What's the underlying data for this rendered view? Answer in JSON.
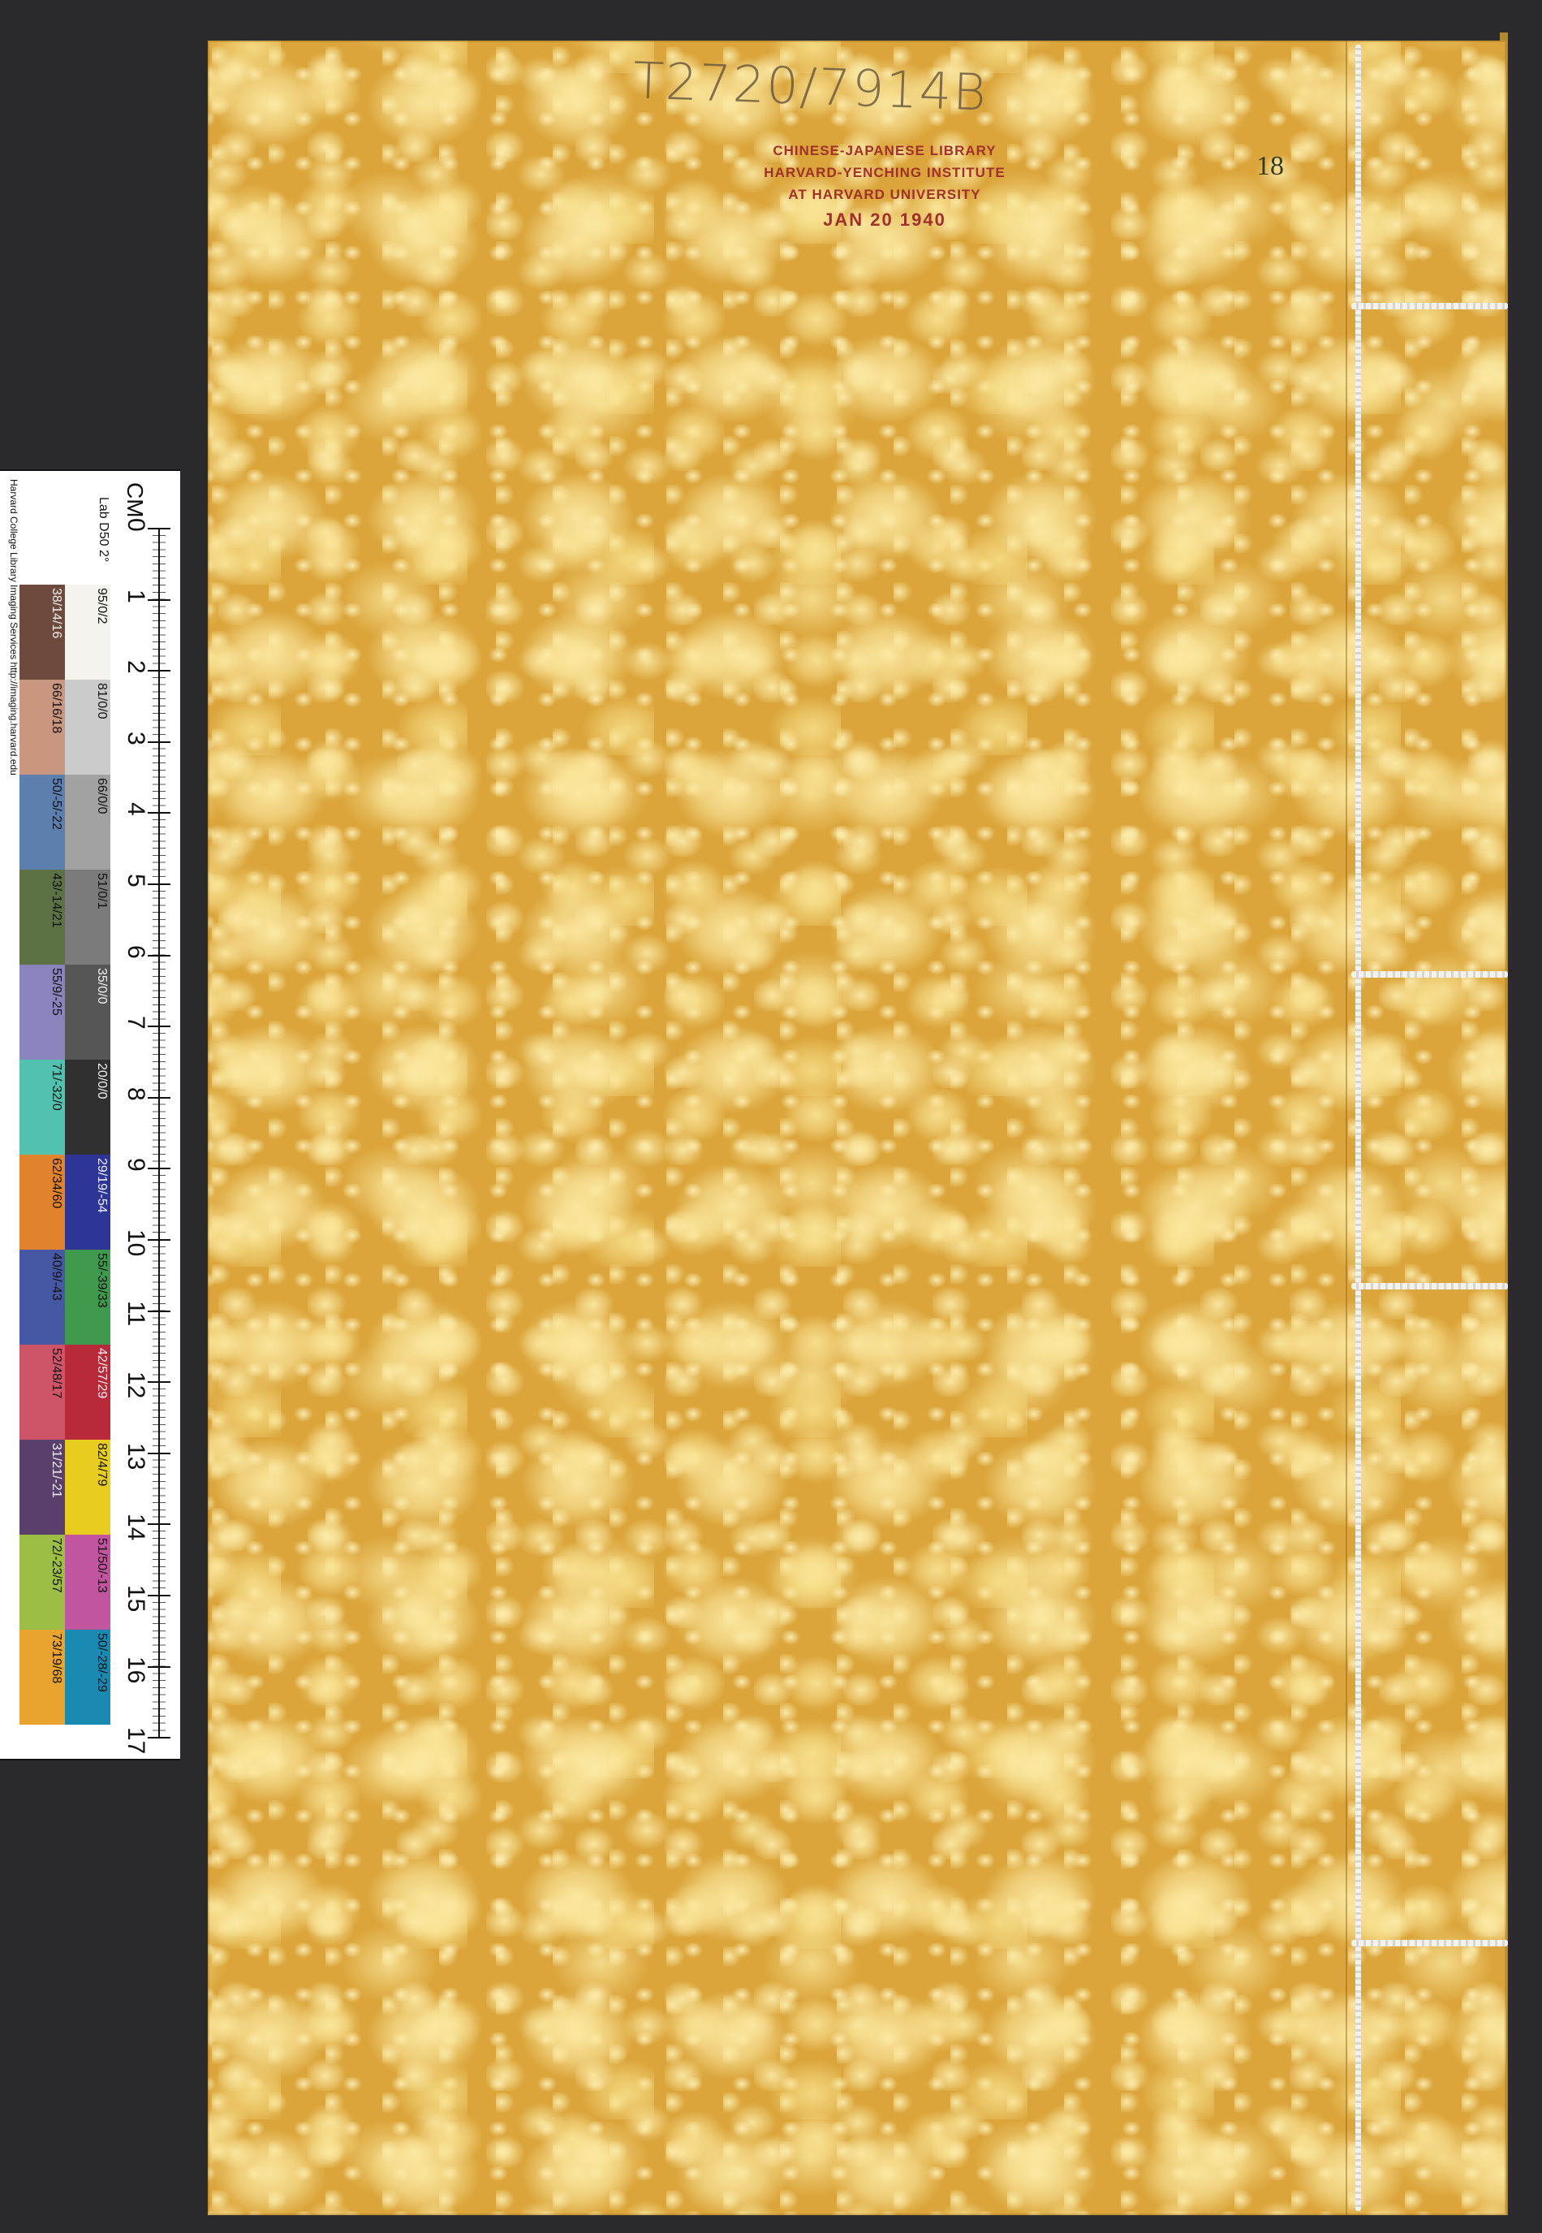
{
  "cover": {
    "handwritten_call_number": "T2720/7914B",
    "volume_number": "18",
    "stamp": {
      "line1": "CHINESE-JAPANESE LIBRARY",
      "line2": "HARVARD-YENCHING INSTITUTE",
      "line3": "AT HARVARD UNIVERSITY",
      "date": "JAN 20 1940"
    }
  },
  "color_target": {
    "credit": "Harvard College Library Imaging Services http://imaging.harvard.edu",
    "unit": "CM",
    "header": "Lab D50 2°",
    "ruler_numbers": [
      "0",
      "1",
      "2",
      "3",
      "4",
      "5",
      "6",
      "7",
      "8",
      "9",
      "10",
      "11",
      "12",
      "13",
      "14",
      "15",
      "16",
      "17"
    ],
    "column_a": [
      {
        "label": "38/14/16",
        "color": "#6e4a3c"
      },
      {
        "label": "66/16/18",
        "color": "#c99680"
      },
      {
        "label": "50/-5/-22",
        "color": "#5d7fae"
      },
      {
        "label": "43/-14/21",
        "color": "#5c7245"
      },
      {
        "label": "55/9/-25",
        "color": "#8a84bc"
      },
      {
        "label": "71/-32/0",
        "color": "#52c1b0"
      },
      {
        "label": "62/34/60",
        "color": "#e1822c"
      },
      {
        "label": "40/9/-43",
        "color": "#4658a3"
      },
      {
        "label": "52/48/17",
        "color": "#ce5467"
      },
      {
        "label": "31/21/-21",
        "color": "#5a3f6c"
      },
      {
        "label": "72/-23/57",
        "color": "#9dbe45"
      },
      {
        "label": "73/19/68",
        "color": "#e8a42f"
      }
    ],
    "column_b": [
      {
        "label": "95/0/2",
        "color": "#f4f3ee"
      },
      {
        "label": "81/0/0",
        "color": "#cbcbcb"
      },
      {
        "label": "66/0/0",
        "color": "#a2a2a2"
      },
      {
        "label": "51/0/1",
        "color": "#7b7b7b"
      },
      {
        "label": "35/0/0",
        "color": "#555555"
      },
      {
        "label": "20/0/0",
        "color": "#303030"
      },
      {
        "label": "29/19/-54",
        "color": "#2d3597"
      },
      {
        "label": "55/-39/33",
        "color": "#3f9a4d"
      },
      {
        "label": "42/57/29",
        "color": "#b82a39"
      },
      {
        "label": "82/4/79",
        "color": "#e8cc1f"
      },
      {
        "label": "51/50/-13",
        "color": "#c2559f"
      },
      {
        "label": "50/-28/-29",
        "color": "#1a8ab3"
      }
    ]
  }
}
